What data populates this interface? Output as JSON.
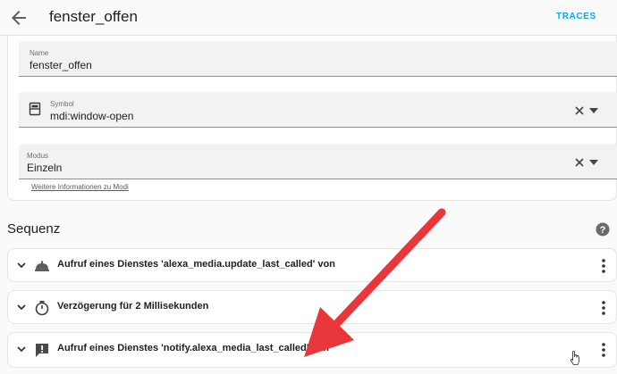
{
  "header": {
    "title": "fenster_offen",
    "traces_label": "TRACES",
    "back_icon": "arrow-left-icon"
  },
  "settings": {
    "name_field": {
      "label": "Name",
      "value": "fenster_offen"
    },
    "symbol_field": {
      "label": "Symbol",
      "value": "mdi:window-open",
      "icon": "window-open-icon"
    },
    "mode_field": {
      "label": "Modus",
      "value": "Einzeln"
    },
    "mode_help_link": "Weitere Informationen zu Modi"
  },
  "sequence": {
    "title": "Sequenz",
    "help_icon": "help-circle-icon",
    "actions": [
      {
        "icon": "bell-service-icon",
        "text": "Aufruf eines Dienstes 'alexa_media.update_last_called' von"
      },
      {
        "icon": "timer-icon",
        "text": "Verzögerung für 2 Millisekunden"
      },
      {
        "icon": "message-alert-icon",
        "text": "Aufruf eines Dienstes 'notify.alexa_media_last_called' von"
      }
    ]
  },
  "colors": {
    "accent": "#03a9f4",
    "annotation_arrow": "#e8363a"
  }
}
